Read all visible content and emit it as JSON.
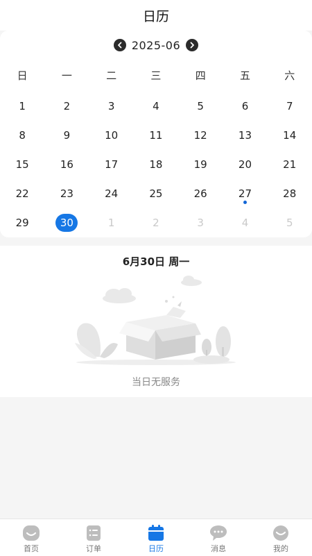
{
  "header": {
    "title": "日历"
  },
  "calendar": {
    "month": "2025-06",
    "weekdays": [
      "日",
      "一",
      "二",
      "三",
      "四",
      "五",
      "六"
    ],
    "weeks": [
      [
        {
          "d": "1"
        },
        {
          "d": "2"
        },
        {
          "d": "3"
        },
        {
          "d": "4"
        },
        {
          "d": "5"
        },
        {
          "d": "6"
        },
        {
          "d": "7"
        }
      ],
      [
        {
          "d": "8"
        },
        {
          "d": "9"
        },
        {
          "d": "10"
        },
        {
          "d": "11"
        },
        {
          "d": "12"
        },
        {
          "d": "13"
        },
        {
          "d": "14"
        }
      ],
      [
        {
          "d": "15"
        },
        {
          "d": "16"
        },
        {
          "d": "17"
        },
        {
          "d": "18"
        },
        {
          "d": "19"
        },
        {
          "d": "20"
        },
        {
          "d": "21"
        }
      ],
      [
        {
          "d": "22"
        },
        {
          "d": "23"
        },
        {
          "d": "24"
        },
        {
          "d": "25"
        },
        {
          "d": "26"
        },
        {
          "d": "27",
          "dot": true
        },
        {
          "d": "28"
        }
      ],
      [
        {
          "d": "29"
        },
        {
          "d": "30",
          "selected": true
        },
        {
          "d": "1",
          "other": true
        },
        {
          "d": "2",
          "other": true
        },
        {
          "d": "3",
          "other": true
        },
        {
          "d": "4",
          "other": true
        },
        {
          "d": "5",
          "other": true
        }
      ]
    ],
    "accent_color": "#1677e5"
  },
  "detail": {
    "date_label": "6月30日 周一",
    "empty_text": "当日无服务"
  },
  "tabbar": {
    "items": [
      {
        "label": "首页",
        "icon": "home-icon",
        "active": false
      },
      {
        "label": "订单",
        "icon": "order-list-icon",
        "active": false
      },
      {
        "label": "日历",
        "icon": "calendar-icon",
        "active": true
      },
      {
        "label": "消息",
        "icon": "message-icon",
        "active": false
      },
      {
        "label": "我的",
        "icon": "profile-icon",
        "active": false
      }
    ]
  }
}
